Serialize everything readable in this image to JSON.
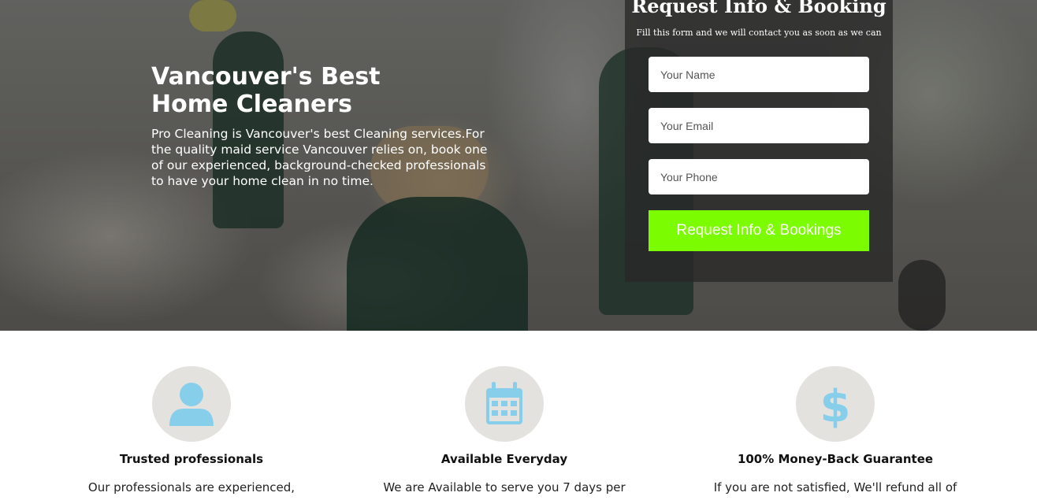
{
  "hero": {
    "title_line1": "Vancouver's Best",
    "title_line2": "Home Cleaners",
    "description": "Pro Cleaning is Vancouver's best Cleaning services.For the quality maid service Vancouver relies on, book one of our experienced, background-checked professionals to have your home clean in no time."
  },
  "form": {
    "title": "Request Info & Booking",
    "subtitle": "Fill this form and we will contact you as soon as we can",
    "name_placeholder": "Your Name",
    "email_placeholder": "Your Email",
    "phone_placeholder": "Your Phone",
    "submit_label": "Request Info & Bookings",
    "submit_color": "#7cfc00"
  },
  "features": [
    {
      "icon": "user-icon",
      "title": "Trusted professionals",
      "text": "Our professionals are experienced,"
    },
    {
      "icon": "calendar-icon",
      "title": "Available Everyday",
      "text": "We are Available to serve you 7 days per"
    },
    {
      "icon": "dollar-icon",
      "title": "100% Money-Back Guarantee",
      "text": "If you are not satisfied, We'll refund all of"
    }
  ],
  "colors": {
    "icon_color": "#87ceeb",
    "icon_bg": "#e4e2df"
  }
}
